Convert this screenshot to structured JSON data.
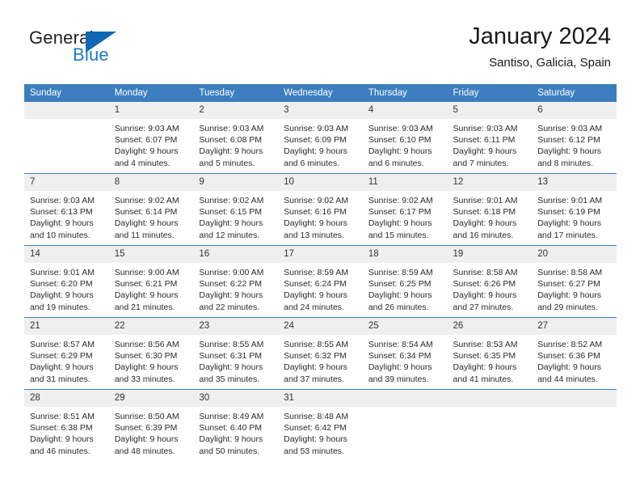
{
  "brand": {
    "name_part1": "General",
    "name_part2": "Blue",
    "logo_icon": "triangle-logo-icon",
    "accent_color": "#1f7ac4"
  },
  "header": {
    "title": "January 2024",
    "location": "Santiso, Galicia, Spain"
  },
  "calendar": {
    "header_bg": "#3c7ebf",
    "date_band_bg": "#efefef",
    "weekday_headers": [
      "Sunday",
      "Monday",
      "Tuesday",
      "Wednesday",
      "Thursday",
      "Friday",
      "Saturday"
    ],
    "weeks": [
      [
        {
          "date": "",
          "empty": true,
          "sunrise": "",
          "sunset": "",
          "daylight_line1": "",
          "daylight_line2": ""
        },
        {
          "date": "1",
          "sunrise": "Sunrise: 9:03 AM",
          "sunset": "Sunset: 6:07 PM",
          "daylight_line1": "Daylight: 9 hours",
          "daylight_line2": "and 4 minutes."
        },
        {
          "date": "2",
          "sunrise": "Sunrise: 9:03 AM",
          "sunset": "Sunset: 6:08 PM",
          "daylight_line1": "Daylight: 9 hours",
          "daylight_line2": "and 5 minutes."
        },
        {
          "date": "3",
          "sunrise": "Sunrise: 9:03 AM",
          "sunset": "Sunset: 6:09 PM",
          "daylight_line1": "Daylight: 9 hours",
          "daylight_line2": "and 6 minutes."
        },
        {
          "date": "4",
          "sunrise": "Sunrise: 9:03 AM",
          "sunset": "Sunset: 6:10 PM",
          "daylight_line1": "Daylight: 9 hours",
          "daylight_line2": "and 6 minutes."
        },
        {
          "date": "5",
          "sunrise": "Sunrise: 9:03 AM",
          "sunset": "Sunset: 6:11 PM",
          "daylight_line1": "Daylight: 9 hours",
          "daylight_line2": "and 7 minutes."
        },
        {
          "date": "6",
          "sunrise": "Sunrise: 9:03 AM",
          "sunset": "Sunset: 6:12 PM",
          "daylight_line1": "Daylight: 9 hours",
          "daylight_line2": "and 8 minutes."
        }
      ],
      [
        {
          "date": "7",
          "sunrise": "Sunrise: 9:03 AM",
          "sunset": "Sunset: 6:13 PM",
          "daylight_line1": "Daylight: 9 hours",
          "daylight_line2": "and 10 minutes."
        },
        {
          "date": "8",
          "sunrise": "Sunrise: 9:02 AM",
          "sunset": "Sunset: 6:14 PM",
          "daylight_line1": "Daylight: 9 hours",
          "daylight_line2": "and 11 minutes."
        },
        {
          "date": "9",
          "sunrise": "Sunrise: 9:02 AM",
          "sunset": "Sunset: 6:15 PM",
          "daylight_line1": "Daylight: 9 hours",
          "daylight_line2": "and 12 minutes."
        },
        {
          "date": "10",
          "sunrise": "Sunrise: 9:02 AM",
          "sunset": "Sunset: 6:16 PM",
          "daylight_line1": "Daylight: 9 hours",
          "daylight_line2": "and 13 minutes."
        },
        {
          "date": "11",
          "sunrise": "Sunrise: 9:02 AM",
          "sunset": "Sunset: 6:17 PM",
          "daylight_line1": "Daylight: 9 hours",
          "daylight_line2": "and 15 minutes."
        },
        {
          "date": "12",
          "sunrise": "Sunrise: 9:01 AM",
          "sunset": "Sunset: 6:18 PM",
          "daylight_line1": "Daylight: 9 hours",
          "daylight_line2": "and 16 minutes."
        },
        {
          "date": "13",
          "sunrise": "Sunrise: 9:01 AM",
          "sunset": "Sunset: 6:19 PM",
          "daylight_line1": "Daylight: 9 hours",
          "daylight_line2": "and 17 minutes."
        }
      ],
      [
        {
          "date": "14",
          "sunrise": "Sunrise: 9:01 AM",
          "sunset": "Sunset: 6:20 PM",
          "daylight_line1": "Daylight: 9 hours",
          "daylight_line2": "and 19 minutes."
        },
        {
          "date": "15",
          "sunrise": "Sunrise: 9:00 AM",
          "sunset": "Sunset: 6:21 PM",
          "daylight_line1": "Daylight: 9 hours",
          "daylight_line2": "and 21 minutes."
        },
        {
          "date": "16",
          "sunrise": "Sunrise: 9:00 AM",
          "sunset": "Sunset: 6:22 PM",
          "daylight_line1": "Daylight: 9 hours",
          "daylight_line2": "and 22 minutes."
        },
        {
          "date": "17",
          "sunrise": "Sunrise: 8:59 AM",
          "sunset": "Sunset: 6:24 PM",
          "daylight_line1": "Daylight: 9 hours",
          "daylight_line2": "and 24 minutes."
        },
        {
          "date": "18",
          "sunrise": "Sunrise: 8:59 AM",
          "sunset": "Sunset: 6:25 PM",
          "daylight_line1": "Daylight: 9 hours",
          "daylight_line2": "and 26 minutes."
        },
        {
          "date": "19",
          "sunrise": "Sunrise: 8:58 AM",
          "sunset": "Sunset: 6:26 PM",
          "daylight_line1": "Daylight: 9 hours",
          "daylight_line2": "and 27 minutes."
        },
        {
          "date": "20",
          "sunrise": "Sunrise: 8:58 AM",
          "sunset": "Sunset: 6:27 PM",
          "daylight_line1": "Daylight: 9 hours",
          "daylight_line2": "and 29 minutes."
        }
      ],
      [
        {
          "date": "21",
          "sunrise": "Sunrise: 8:57 AM",
          "sunset": "Sunset: 6:29 PM",
          "daylight_line1": "Daylight: 9 hours",
          "daylight_line2": "and 31 minutes."
        },
        {
          "date": "22",
          "sunrise": "Sunrise: 8:56 AM",
          "sunset": "Sunset: 6:30 PM",
          "daylight_line1": "Daylight: 9 hours",
          "daylight_line2": "and 33 minutes."
        },
        {
          "date": "23",
          "sunrise": "Sunrise: 8:55 AM",
          "sunset": "Sunset: 6:31 PM",
          "daylight_line1": "Daylight: 9 hours",
          "daylight_line2": "and 35 minutes."
        },
        {
          "date": "24",
          "sunrise": "Sunrise: 8:55 AM",
          "sunset": "Sunset: 6:32 PM",
          "daylight_line1": "Daylight: 9 hours",
          "daylight_line2": "and 37 minutes."
        },
        {
          "date": "25",
          "sunrise": "Sunrise: 8:54 AM",
          "sunset": "Sunset: 6:34 PM",
          "daylight_line1": "Daylight: 9 hours",
          "daylight_line2": "and 39 minutes."
        },
        {
          "date": "26",
          "sunrise": "Sunrise: 8:53 AM",
          "sunset": "Sunset: 6:35 PM",
          "daylight_line1": "Daylight: 9 hours",
          "daylight_line2": "and 41 minutes."
        },
        {
          "date": "27",
          "sunrise": "Sunrise: 8:52 AM",
          "sunset": "Sunset: 6:36 PM",
          "daylight_line1": "Daylight: 9 hours",
          "daylight_line2": "and 44 minutes."
        }
      ],
      [
        {
          "date": "28",
          "sunrise": "Sunrise: 8:51 AM",
          "sunset": "Sunset: 6:38 PM",
          "daylight_line1": "Daylight: 9 hours",
          "daylight_line2": "and 46 minutes."
        },
        {
          "date": "29",
          "sunrise": "Sunrise: 8:50 AM",
          "sunset": "Sunset: 6:39 PM",
          "daylight_line1": "Daylight: 9 hours",
          "daylight_line2": "and 48 minutes."
        },
        {
          "date": "30",
          "sunrise": "Sunrise: 8:49 AM",
          "sunset": "Sunset: 6:40 PM",
          "daylight_line1": "Daylight: 9 hours",
          "daylight_line2": "and 50 minutes."
        },
        {
          "date": "31",
          "sunrise": "Sunrise: 8:48 AM",
          "sunset": "Sunset: 6:42 PM",
          "daylight_line1": "Daylight: 9 hours",
          "daylight_line2": "and 53 minutes."
        },
        {
          "date": "",
          "empty": true,
          "sunrise": "",
          "sunset": "",
          "daylight_line1": "",
          "daylight_line2": ""
        },
        {
          "date": "",
          "empty": true,
          "sunrise": "",
          "sunset": "",
          "daylight_line1": "",
          "daylight_line2": ""
        },
        {
          "date": "",
          "empty": true,
          "sunrise": "",
          "sunset": "",
          "daylight_line1": "",
          "daylight_line2": ""
        }
      ]
    ]
  }
}
